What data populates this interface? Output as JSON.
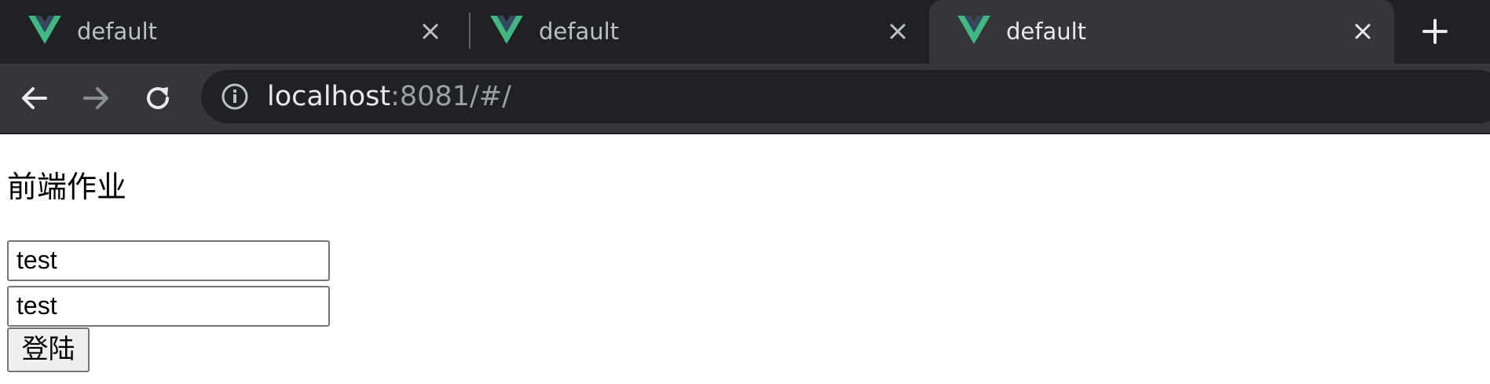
{
  "browser": {
    "tabs": [
      {
        "title": "default",
        "favicon": "vue-logo-icon",
        "active": false
      },
      {
        "title": "default",
        "favicon": "vue-logo-icon",
        "active": false
      },
      {
        "title": "default",
        "favicon": "vue-logo-icon",
        "active": true
      }
    ],
    "new_tab_icon": "plus-icon",
    "address": {
      "host": "localhost",
      "rest": ":8081/#/",
      "security_icon": "info-icon"
    },
    "nav_icons": [
      "back-arrow-icon",
      "forward-arrow-icon",
      "reload-icon"
    ],
    "colors": {
      "tabstrip_bg": "#202124",
      "active_tab_bg": "#35363a",
      "vue_green": "#41b883",
      "vue_dark": "#35495e"
    }
  },
  "page": {
    "heading": "前端作业",
    "username_value": "test",
    "password_value": "test",
    "login_label": "登陆"
  }
}
